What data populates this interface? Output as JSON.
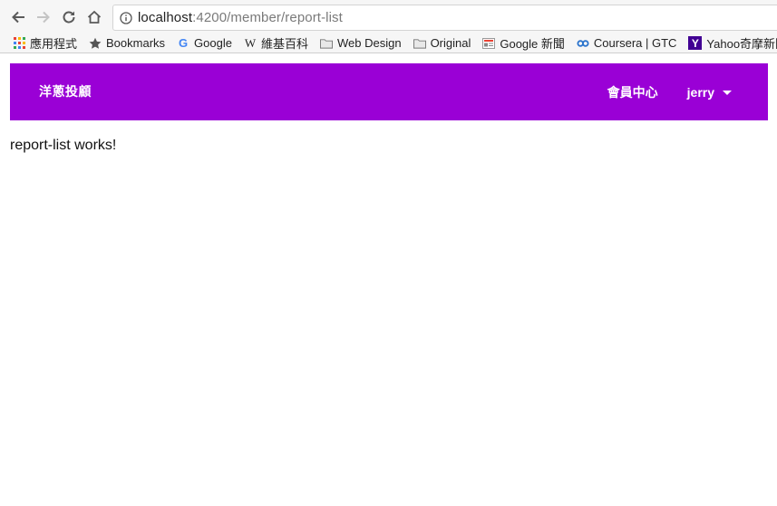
{
  "browser": {
    "url_host": "localhost",
    "url_rest": ":4200/member/report-list"
  },
  "bookmarks": [
    {
      "label": "應用程式",
      "icon": "apps-grid-icon"
    },
    {
      "label": "Bookmarks",
      "icon": "star-icon"
    },
    {
      "label": "Google",
      "icon": "google-g-icon"
    },
    {
      "label": "維基百科",
      "icon": "wikipedia-w-icon"
    },
    {
      "label": "Web Design",
      "icon": "folder-icon"
    },
    {
      "label": "Original",
      "icon": "folder-icon"
    },
    {
      "label": "Google 新聞",
      "icon": "news-icon"
    },
    {
      "label": "Coursera | GTC",
      "icon": "coursera-icon"
    },
    {
      "label": "Yahoo奇摩新聞",
      "icon": "yahoo-y-icon"
    }
  ],
  "navbar": {
    "brand": "洋蔥投顧",
    "member_center": "會員中心",
    "user": "jerry",
    "color": "#9a00d6"
  },
  "content": {
    "text": "report-list works!"
  }
}
